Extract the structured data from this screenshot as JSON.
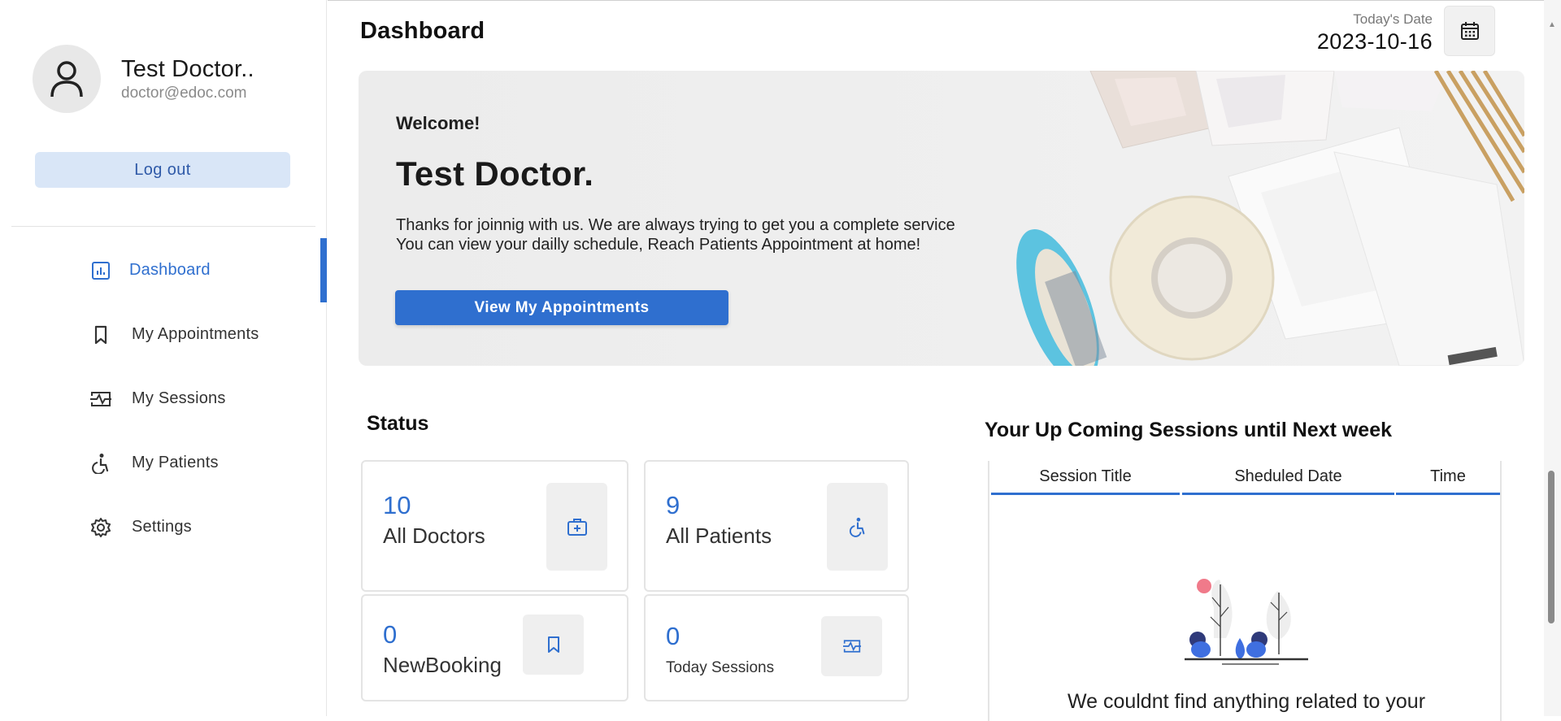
{
  "profile": {
    "name": "Test Doctor..",
    "email": "doctor@edoc.com"
  },
  "sidebar": {
    "logout_label": "Log out",
    "items": [
      {
        "label": "Dashboard",
        "icon": "dashboard-icon",
        "active": true
      },
      {
        "label": "My Appointments",
        "icon": "bookmark-icon"
      },
      {
        "label": "My Sessions",
        "icon": "sessions-icon"
      },
      {
        "label": "My Patients",
        "icon": "wheelchair-icon"
      },
      {
        "label": "Settings",
        "icon": "gear-icon"
      }
    ]
  },
  "header": {
    "title": "Dashboard",
    "date_label": "Today's Date",
    "date_value": "2023-10-16",
    "calendar_icon": "calendar-icon"
  },
  "hero": {
    "welcome": "Welcome!",
    "name": "Test Doctor.",
    "line1": "Thanks for joinnig with us. We are always trying to get you a complete service",
    "line2": "You can view your dailly schedule, Reach Patients Appointment at home!",
    "button_label": "View My Appointments"
  },
  "status": {
    "title": "Status",
    "cards": [
      {
        "value": "10",
        "label": "All Doctors",
        "icon": "medical-kit-icon"
      },
      {
        "value": "9",
        "label": "All Patients",
        "icon": "wheelchair-icon"
      },
      {
        "value": "0",
        "label": "NewBooking",
        "icon": "bookmark-icon"
      },
      {
        "value": "0",
        "label": "Today Sessions",
        "icon": "sessions-icon"
      }
    ]
  },
  "upcoming": {
    "title": "Your Up Coming Sessions until Next week",
    "columns": [
      "Session Title",
      "Sheduled Date",
      "Time"
    ],
    "empty_text": "We couldnt find anything related to your"
  },
  "colors": {
    "accent": "#2f6fcf",
    "logout_bg": "#d9e6f7",
    "card_icon_bg": "#efefef"
  }
}
